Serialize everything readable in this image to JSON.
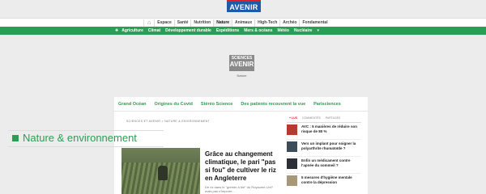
{
  "brand": {
    "logo_line1": "SCIENCES",
    "logo_line2": "AVENIR",
    "caption": "Nature"
  },
  "nav_main": {
    "home_icon": "home-icon",
    "items": [
      "Espace",
      "Santé",
      "Nutrition",
      "Nature",
      "Animaux",
      "High-Tech",
      "Archéo",
      "Fondamental"
    ],
    "active": "Nature"
  },
  "nav_sub": {
    "items": [
      "Agriculture",
      "Climat",
      "Développement durable",
      "Expéditions",
      "Mers & océans",
      "Météo",
      "Nucléaire"
    ],
    "more_icon": "chevron-down-icon"
  },
  "topics": [
    "Grand Océan",
    "Origines du Covid",
    "Stéréo Science",
    "Des patients recouvrent la vue",
    "Parisciences"
  ],
  "breadcrumb": [
    "SCIENCES ET AVENIR",
    "NATURE & ENVIRONNEMENT"
  ],
  "section": {
    "title": "Nature & environnement"
  },
  "lead_article": {
    "title": "Grâce au changement climatique, le pari \"pas si fou\" de cultiver le riz en Angleterre",
    "excerpt": "De riz dans le \"grenier à blé\" du Royaume-Uni? mais pas n'importe..."
  },
  "sidebar": {
    "tabs": [
      "+ LUS",
      "COMMENTÉS",
      "PARTAGÉS"
    ],
    "active_tab": "+ LUS",
    "items": [
      {
        "text": "AVC : 5 manières de réduire son risque de 80 %",
        "thumb": "#b73a2c"
      },
      {
        "text": "Vers un implant pour soigner la polyarthrite rhumatoïde ?",
        "thumb": "#3c4c5a"
      },
      {
        "text": "Enfin un médicament contre l'apnée du sommeil ?",
        "thumb": "#2c2f38"
      },
      {
        "text": "5 mesures d'hygiène mentale contre la dépression",
        "thumb": "#a89878"
      }
    ]
  }
}
